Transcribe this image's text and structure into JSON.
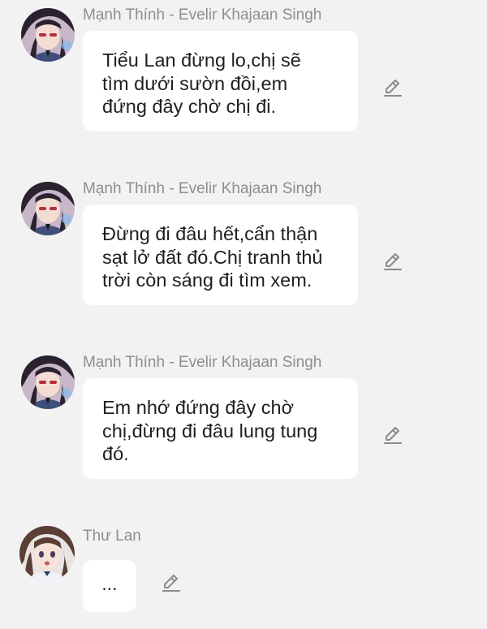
{
  "conversation": {
    "messages": [
      {
        "sender": "Mạnh Thính - Evelir Khajaan Singh",
        "avatar_icon": "anime-girl-dark-hair-avatar",
        "lines": [
          "Tiểu Lan đừng lo,chị sẽ",
          "tìm dưới sườn đồi,em",
          "đứng đây chờ chị đi."
        ]
      },
      {
        "sender": "Mạnh Thính - Evelir Khajaan Singh",
        "avatar_icon": "anime-girl-dark-hair-avatar",
        "lines": [
          "Đừng đi đâu hết,cẩn thận",
          "sạt lở đất đó.Chị tranh thủ",
          "trời còn sáng đi tìm xem."
        ]
      },
      {
        "sender": "Mạnh Thính - Evelir Khajaan Singh",
        "avatar_icon": "anime-girl-dark-hair-avatar",
        "lines": [
          "Em nhớ đứng đây chờ",
          "chị,đừng đi đâu lung tung",
          "đó."
        ]
      },
      {
        "sender": "Thư Lan",
        "avatar_icon": "anime-girl-brown-hair-avatar",
        "text": "..."
      }
    ]
  },
  "icons": {
    "edit": "pencil-edit-icon"
  },
  "colors": {
    "background": "#f2f2f3",
    "bubble": "#ffffff",
    "sender_text": "#8d8d93",
    "message_text": "#1f1f22",
    "icon": "#8a8a90"
  }
}
